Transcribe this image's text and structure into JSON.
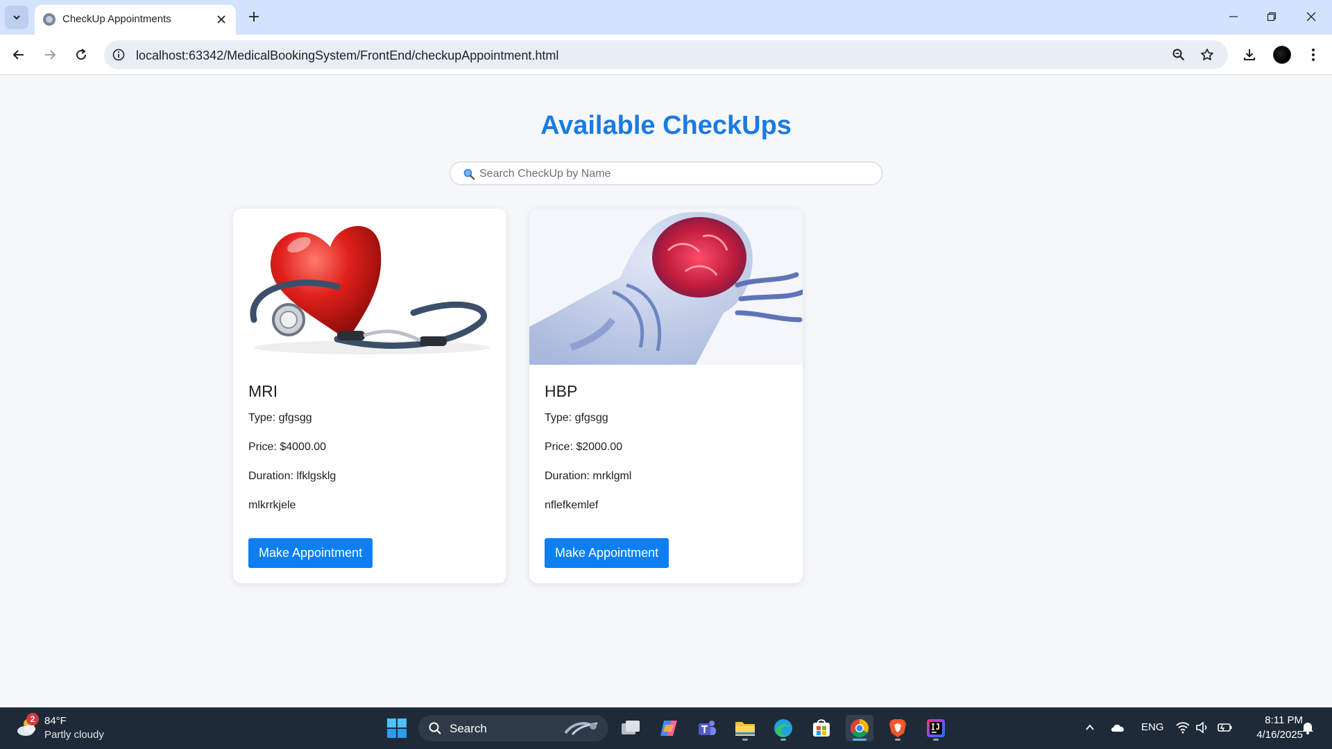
{
  "browser": {
    "tab_title": "CheckUp Appointments",
    "url": "localhost:63342/MedicalBookingSystem/FrontEnd/checkupAppointment.html"
  },
  "page": {
    "title": "Available CheckUps",
    "search": {
      "placeholder": "Search CheckUp by Name",
      "value": ""
    },
    "cards": [
      {
        "name": "MRI",
        "type": "Type: gfgsgg",
        "price": "Price: $4000.00",
        "duration": "Duration: lfklgsklg",
        "description": "mlkrrkjele",
        "button": "Make Appointment",
        "image": "heart-stethoscope"
      },
      {
        "name": "HBP",
        "type": "Type: gfgsgg",
        "price": "Price: $2000.00",
        "duration": "Duration: mrklgml",
        "description": "nflefkemlef",
        "button": "Make Appointment",
        "image": "brain-xray"
      }
    ]
  },
  "taskbar": {
    "weather": {
      "badge": "2",
      "temp": "84°F",
      "desc": "Partly cloudy"
    },
    "search_label": "Search",
    "language": "ENG",
    "time": "8:11 PM",
    "date": "4/16/2025"
  },
  "colors": {
    "title": "#1a7be0",
    "button": "#0d7ff2",
    "tabbar": "#d3e3fd",
    "taskbar": "#1f2a38"
  }
}
